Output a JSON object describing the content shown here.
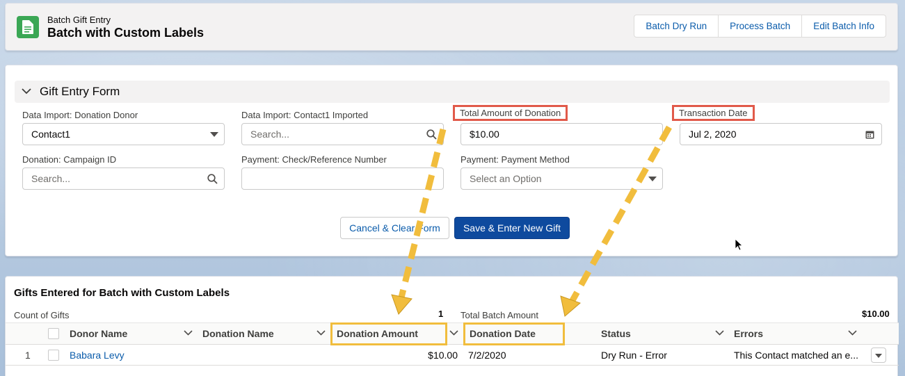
{
  "header": {
    "subtitle": "Batch Gift Entry",
    "title": "Batch with Custom Labels",
    "buttons": [
      "Batch Dry Run",
      "Process Batch",
      "Edit Batch Info"
    ]
  },
  "form": {
    "section_title": "Gift Entry Form",
    "fields": {
      "donor_label": "Data Import: Donation Donor",
      "donor_value": "Contact1",
      "contact_label": "Data Import: Contact1 Imported",
      "contact_placeholder": "Search...",
      "amount_label": "Total Amount of Donation",
      "amount_value": "$10.00",
      "date_label": "Transaction Date",
      "date_value": "Jul 2, 2020",
      "campaign_label": "Donation: Campaign ID",
      "campaign_placeholder": "Search...",
      "check_label": "Payment: Check/Reference Number",
      "check_value": "",
      "method_label": "Payment: Payment Method",
      "method_placeholder": "Select an Option"
    },
    "cancel_label": "Cancel & Clear Form",
    "save_label": "Save & Enter New Gift"
  },
  "gifts": {
    "title": "Gifts Entered for Batch with Custom Labels",
    "count_label": "Count of Gifts",
    "count_value": "1",
    "total_label": "Total Batch Amount",
    "total_value": "$10.00",
    "columns": [
      "Donor Name",
      "Donation Name",
      "Donation Amount",
      "Donation Date",
      "Status",
      "Errors"
    ],
    "rows": [
      {
        "num": "1",
        "donor": "Babara Levy",
        "donation_name": "",
        "amount": "$10.00",
        "date": "7/2/2020",
        "status": "Dry Run - Error",
        "errors": "This Contact matched an e..."
      }
    ]
  },
  "colors": {
    "brand": "#0e4a9e",
    "link": "#0b5cab",
    "icon_green": "#3ba755",
    "highlight_red": "#e15a4a",
    "highlight_yellow": "#f1bd3d"
  },
  "icons": [
    "document-icon",
    "chevron-down-icon",
    "dropdown-arrow-icon",
    "search-icon",
    "calendar-icon",
    "cursor-icon"
  ]
}
